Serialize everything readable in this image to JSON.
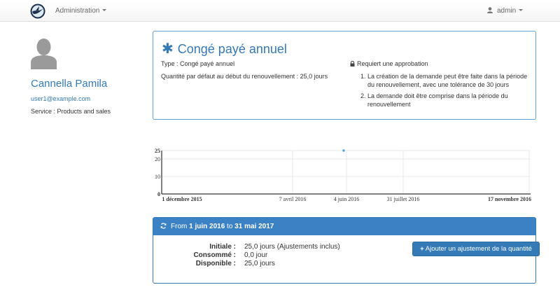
{
  "navbar": {
    "admin_menu_label": "Administration",
    "user_menu_label": "admin"
  },
  "profile": {
    "name": "Cannella Pamila",
    "email": "user1@example.com",
    "service": "Service : Products and sales"
  },
  "leave": {
    "title": "Congé payé annuel",
    "type": "Type : Congé payé annuel",
    "default_quantity": "Quantité par défaut au début du renouvellement : 25,0 jours",
    "approval_label": "Requiert une approbation",
    "rules": [
      "La création de la demande peut être faite dans la période du renouvellement, avec une tolérance de 30 jours",
      "La demande doit être comprise dans la période du renouvellement"
    ]
  },
  "chart_data": {
    "type": "scatter",
    "x_ticks": [
      "1 décembre 2015",
      "7 avril 2016",
      "4 juin 2016",
      "31 juillet 2016",
      "17 novembre 2016"
    ],
    "y_ticks": [
      "25",
      "20",
      "10",
      "0"
    ],
    "ylim": [
      0,
      25
    ],
    "points": [
      {
        "x": "1 juin 2016",
        "y": 25
      }
    ],
    "color": "#5aa6e0"
  },
  "period": {
    "from_label": "From",
    "start": "1 juin 2016",
    "to_label": "to",
    "end": "31 mai 2017",
    "initial_label": "Initiale :",
    "initial_value": "25,0 jours (Ajustements inclus)",
    "consumed_label": "Consommé :",
    "consumed_value": "0,0 jour",
    "available_label": "Disponible :",
    "available_value": "25,0 jours",
    "add_button_label": "Ajouter un ajustement de la quantité"
  },
  "colors": {
    "primary": "#337ab7",
    "panel_border": "#5fa3d6"
  }
}
